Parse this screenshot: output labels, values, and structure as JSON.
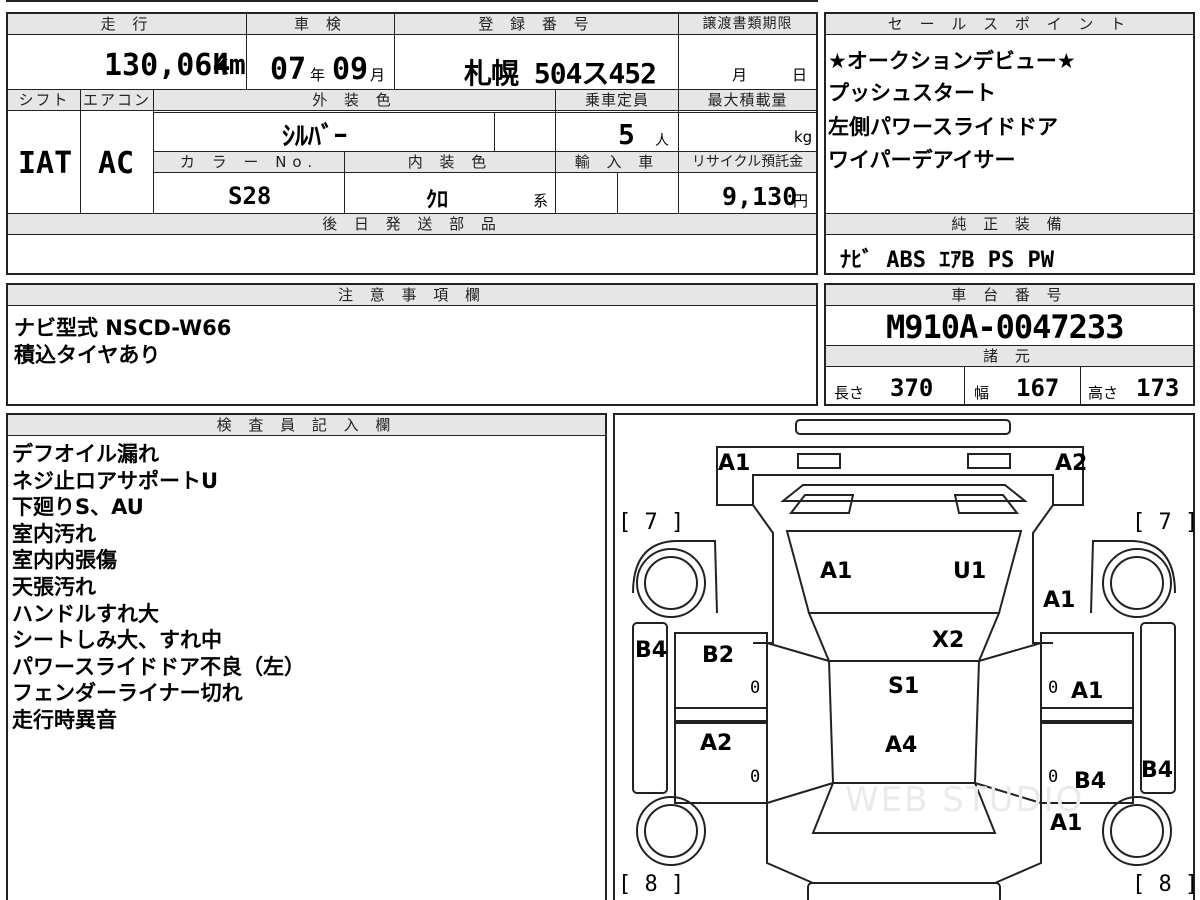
{
  "vehicle": {
    "mileage_header": "走 行",
    "mileage_value": "130,064",
    "mileage_unit": "km",
    "inspection_header": "車 検",
    "inspection_year": "07",
    "inspection_year_unit": "年",
    "inspection_month": "09",
    "inspection_month_unit": "月",
    "registration_header": "登 録 番 号",
    "registration_value": "札幌 504ス452",
    "transfer_header": "譲渡書類期限",
    "transfer_month": "月",
    "transfer_day": "日",
    "shift_header": "シフト",
    "shift_value": "IAT",
    "ac_header": "エアコン",
    "ac_value": "AC",
    "exterior_header": "外 装 色",
    "exterior_value": "ｼﾙﾊﾞｰ",
    "capacity_header": "乗車定員",
    "capacity_value": "5",
    "capacity_unit": "人",
    "maxload_header": "最大積載量",
    "maxload_unit": "kg",
    "color_no_header": "カ ラ ー No.",
    "color_no_value": "S28",
    "interior_header": "内 装 色",
    "interior_value": "ｸﾛ",
    "interior_unit": "系",
    "import_header": "輸 入 車",
    "recycle_header": "リサイクル預託金",
    "recycle_value": "9,130",
    "recycle_unit": "円",
    "later_parts_header": "後 日 発 送 部 品"
  },
  "sales_points": {
    "header": "セ ー ル ス ポ イ ン ト",
    "items": [
      "★オークションデビュー★",
      "プッシュスタート",
      "左側パワースライドドア",
      "ワイパーデアイサー"
    ]
  },
  "genuine_equipment": {
    "header": "純 正 装 備",
    "value": "ﾅﾋﾞ ABS ｴｱB PS PW"
  },
  "notes": {
    "header": "注 意 事 項 欄",
    "lines": [
      "ナビ型式 NSCD-W66",
      "積込タイヤあり"
    ]
  },
  "chassis": {
    "header": "車 台 番 号",
    "value": "M910A-0047233"
  },
  "specs": {
    "header": "諸 元",
    "length_label": "長さ",
    "length_value": "370",
    "width_label": "幅",
    "width_value": "167",
    "height_label": "高さ",
    "height_value": "173"
  },
  "inspector": {
    "header": "検 査 員 記 入 欄",
    "lines": [
      "デフオイル漏れ",
      "ネジ止ロアサポートU",
      "下廻りS、AU",
      "室内汚れ",
      "室内内張傷",
      "天張汚れ",
      "ハンドルすれ大",
      "シートしみ大、すれ中",
      "パワースライドドア不良（左）",
      "フェンダーライナー切れ",
      "走行時異音"
    ]
  },
  "diagram": {
    "tread_front_left": "[ 7 ]",
    "tread_front_right": "[ 7 ]",
    "tread_rear_left": "[ 8 ]",
    "tread_rear_right": "[ 8 ]",
    "labels": {
      "front_left_corner": "A1",
      "front_right_corner": "A2",
      "hood_left": "A1",
      "hood_right": "U1",
      "right_fender": "A1",
      "windshield": "X2",
      "left_rocker": "B4",
      "left_front_door": "B2",
      "roof": "S1",
      "right_front_door": "A1",
      "left_rear_door": "A2",
      "rear_roof": "A4",
      "right_rear_door": "B4",
      "right_rocker": "B4",
      "right_rear_fender": "A1",
      "door_zero_1": "0",
      "door_zero_2": "0",
      "door_zero_3": "0",
      "door_zero_4": "0"
    },
    "watermark": "WEB STUDIO"
  }
}
